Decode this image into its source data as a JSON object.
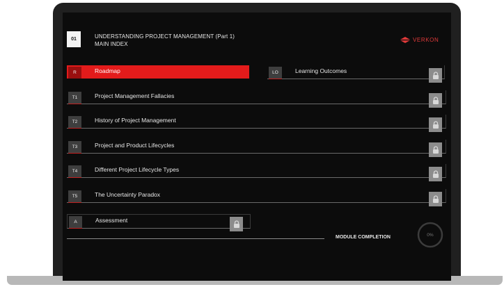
{
  "header": {
    "module_number": "01",
    "title_line1": "UNDERSTANDING PROJECT MANAGEMENT (Part 1)",
    "title_line2": "MAIN INDEX",
    "brand": "VERKON"
  },
  "menu": {
    "roadmap": {
      "tag": "R",
      "label": "Roadmap"
    },
    "learning_outcomes": {
      "tag": "LO",
      "label": "Learning Outcomes"
    },
    "topics": [
      {
        "tag": "T1",
        "label": "Project Management Fallacies"
      },
      {
        "tag": "T2",
        "label": "History of Project Management"
      },
      {
        "tag": "T3",
        "label": "Project and Product Lifecycles"
      },
      {
        "tag": "T4",
        "label": "Different Project Lifecycle Types"
      },
      {
        "tag": "T5",
        "label": "The Uncertainty Paradox"
      }
    ],
    "assessment": {
      "tag": "A",
      "label": "Assessment"
    }
  },
  "completion": {
    "label": "MODULE COMPLETION",
    "percent_text": "0%",
    "percent": 0
  },
  "colors": {
    "accent": "#e31b1b",
    "background": "#0c0c0c",
    "lock": "#8c8c8c"
  },
  "icons": {
    "lock": "lock-icon",
    "brand": "verkon-logo-icon"
  }
}
